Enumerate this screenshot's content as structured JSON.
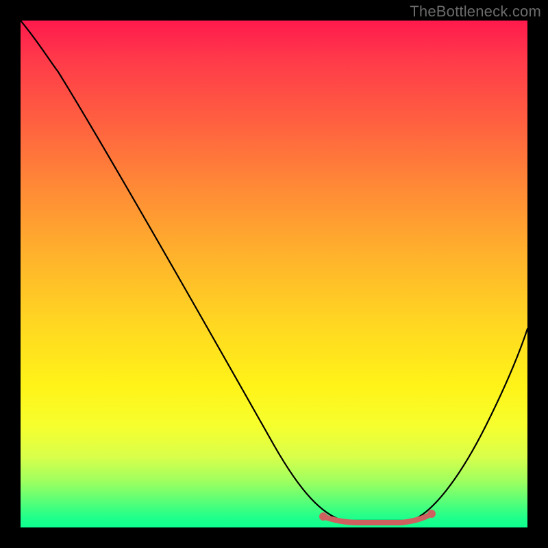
{
  "watermark": "TheBottleneck.com",
  "colors": {
    "frame": "#000000",
    "curve": "#000000",
    "highlight": "#cf6060",
    "watermark": "#6b6b6b"
  },
  "chart_data": {
    "type": "line",
    "title": "",
    "xlabel": "",
    "ylabel": "",
    "xlim": [
      0,
      100
    ],
    "ylim": [
      0,
      100
    ],
    "series": [
      {
        "name": "bottleneck-curve",
        "x": [
          0,
          5,
          10,
          15,
          20,
          25,
          30,
          35,
          40,
          45,
          50,
          55,
          60,
          63,
          67,
          71,
          75,
          80,
          85,
          90,
          95,
          100
        ],
        "y": [
          100,
          94,
          86,
          78,
          70,
          62,
          53,
          45,
          37,
          29,
          21,
          14,
          7,
          3,
          1,
          1,
          1,
          4,
          10,
          18,
          28,
          40
        ]
      }
    ],
    "highlight_range": {
      "x_start": 60,
      "x_end": 77
    },
    "annotations": []
  }
}
